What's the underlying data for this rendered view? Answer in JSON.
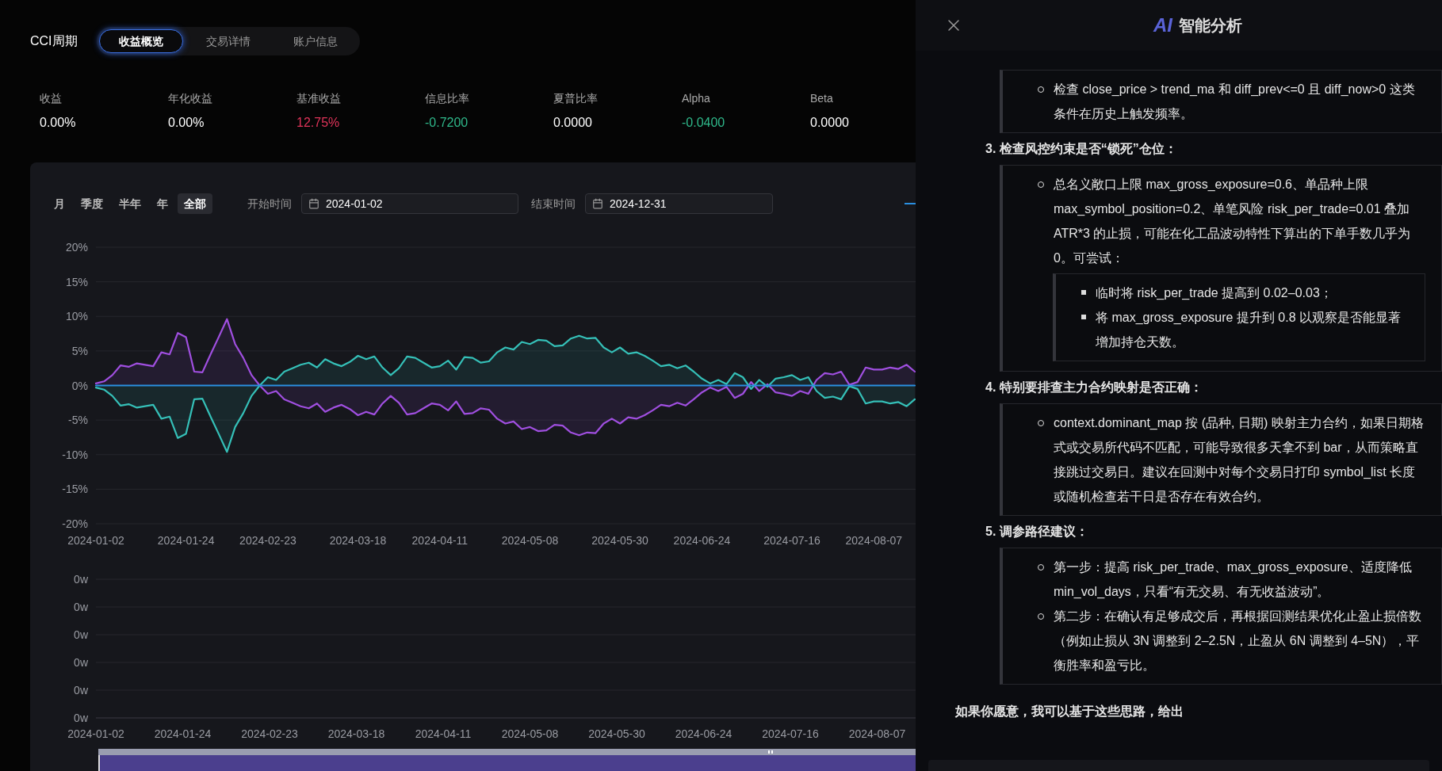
{
  "header": {
    "strategy": "CCI周期",
    "tabs": [
      {
        "label": "收益概览",
        "selected": true
      },
      {
        "label": "交易详情",
        "selected": false
      },
      {
        "label": "账户信息",
        "selected": false
      }
    ]
  },
  "metrics": [
    {
      "label": "收益",
      "value": "0.00%",
      "color": "#ffffff"
    },
    {
      "label": "年化收益",
      "value": "0.00%",
      "color": "#ffffff"
    },
    {
      "label": "基准收益",
      "value": "12.75%",
      "color": "#e0345a"
    },
    {
      "label": "信息比率",
      "value": "-0.7200",
      "color": "#2fb88a"
    },
    {
      "label": "夏普比率",
      "value": "0.0000",
      "color": "#ffffff"
    },
    {
      "label": "Alpha",
      "value": "-0.0400",
      "color": "#2fb88a"
    },
    {
      "label": "Beta",
      "value": "0.0000",
      "color": "#ffffff"
    }
  ],
  "toolbar": {
    "periods": [
      {
        "label": "月",
        "selected": false
      },
      {
        "label": "季度",
        "selected": false
      },
      {
        "label": "半年",
        "selected": false
      },
      {
        "label": "年",
        "selected": false
      },
      {
        "label": "全部",
        "selected": true
      }
    ],
    "start_label": "开始时间",
    "start_value": "2024-01-02",
    "end_label": "结束时间",
    "end_value": "2024-12-31"
  },
  "returns_chart": {
    "chart_data": {
      "type": "line",
      "grid": true,
      "ylim": [
        -20,
        20
      ],
      "categories": [
        "2024-01-02",
        null,
        null,
        null,
        null,
        null,
        null,
        null,
        null,
        null,
        null,
        "2024-01-24",
        null,
        null,
        null,
        null,
        null,
        null,
        null,
        null,
        null,
        "2024-02-23",
        null,
        null,
        null,
        null,
        null,
        null,
        null,
        null,
        null,
        null,
        "2024-03-18",
        null,
        null,
        null,
        null,
        null,
        null,
        null,
        null,
        null,
        "2024-04-11",
        null,
        null,
        null,
        null,
        null,
        null,
        null,
        null,
        null,
        null,
        "2024-05-08",
        null,
        null,
        null,
        null,
        null,
        null,
        null,
        null,
        null,
        null,
        "2024-05-30",
        null,
        null,
        null,
        null,
        null,
        null,
        null,
        null,
        null,
        "2024-06-24",
        null,
        null,
        null,
        null,
        null,
        null,
        null,
        null,
        null,
        null,
        "2024-07-16",
        null,
        null,
        null,
        null,
        null,
        null,
        null,
        null,
        null,
        "2024-08-07",
        null,
        null,
        null,
        null,
        null
      ],
      "yticks": [
        {
          "value": 20,
          "label": "20%"
        },
        {
          "value": 15,
          "label": "15%"
        },
        {
          "value": 10,
          "label": "10%"
        },
        {
          "value": 5,
          "label": "5%"
        },
        {
          "value": 0,
          "label": "0%"
        },
        {
          "value": -5,
          "label": "-5%"
        },
        {
          "value": -10,
          "label": "-10%"
        },
        {
          "value": -15,
          "label": "-15%"
        },
        {
          "value": -20,
          "label": "-20%"
        }
      ],
      "series": [
        {
          "color": "#a04fe0",
          "values": [
            0.3,
            0.6,
            1.5,
            2.9,
            2.7,
            3.2,
            3.0,
            2.8,
            4.8,
            4.5,
            7.6,
            7.0,
            2.0,
            1.9,
            4.5,
            7.0,
            9.6,
            6.0,
            4.0,
            1.5,
            0.0,
            -1.2,
            -0.8,
            -2.0,
            -2.5,
            -3.0,
            -3.3,
            -2.6,
            -3.8,
            -3.2,
            -2.8,
            -3.4,
            -4.3,
            -3.8,
            -4.2,
            -2.6,
            -1.5,
            -2.5,
            -4.2,
            -4.0,
            -3.3,
            -2.6,
            -2.8,
            -3.6,
            -2.3,
            -4.1,
            -4.0,
            -3.3,
            -3.5,
            -4.8,
            -5.5,
            -5.2,
            -6.3,
            -6.0,
            -6.6,
            -6.5,
            -5.7,
            -5.8,
            -6.8,
            -7.2,
            -6.8,
            -6.9,
            -5.5,
            -4.8,
            -5.5,
            -4.6,
            -4.8,
            -4.3,
            -3.6,
            -2.8,
            -3.0,
            -2.5,
            -2.9,
            -2.0,
            -1.0,
            -0.3,
            -0.8,
            -0.2,
            -1.8,
            -1.2,
            0.5,
            -0.8,
            0.2,
            -1.0,
            -1.2,
            -1.5,
            -0.8,
            -1.2,
            0.8,
            1.8,
            1.6,
            2.0,
            0.1,
            0.5,
            2.6,
            2.3,
            2.3,
            2.6,
            2.4,
            3.0,
            2.0
          ]
        },
        {
          "color": "#35c0b8",
          "values": [
            -0.3,
            -0.6,
            -1.5,
            -2.9,
            -2.7,
            -3.2,
            -3.0,
            -2.8,
            -4.8,
            -4.5,
            -7.6,
            -7.0,
            -2.0,
            -1.9,
            -4.5,
            -7.0,
            -9.6,
            -6.0,
            -4.0,
            -1.5,
            0.0,
            1.2,
            0.8,
            2.0,
            2.5,
            3.0,
            3.3,
            2.6,
            3.8,
            3.2,
            2.8,
            3.4,
            4.3,
            3.8,
            4.2,
            2.6,
            1.5,
            2.5,
            4.2,
            4.0,
            3.3,
            2.6,
            2.8,
            3.6,
            2.3,
            4.1,
            4.0,
            3.3,
            3.5,
            4.8,
            5.5,
            5.2,
            6.3,
            6.0,
            6.6,
            6.5,
            5.7,
            5.8,
            6.8,
            7.2,
            6.8,
            6.9,
            5.5,
            4.8,
            5.5,
            4.6,
            4.8,
            4.3,
            3.6,
            2.8,
            3.0,
            2.5,
            2.9,
            2.0,
            1.0,
            0.3,
            0.8,
            0.2,
            1.8,
            1.2,
            -0.5,
            0.8,
            -0.2,
            1.0,
            1.2,
            1.5,
            0.8,
            1.2,
            -0.8,
            -1.8,
            -1.6,
            -2.0,
            -0.1,
            -0.5,
            -2.6,
            -2.3,
            -2.3,
            -2.6,
            -2.4,
            -3.0,
            -2.0
          ]
        },
        {
          "color": "#2a8fe0",
          "values": [
            0,
            0,
            0,
            0,
            0,
            0,
            0,
            0,
            0,
            0,
            0,
            0,
            0,
            0,
            0,
            0,
            0,
            0,
            0,
            0,
            0,
            0,
            0,
            0,
            0,
            0,
            0,
            0,
            0,
            0,
            0,
            0,
            0,
            0,
            0,
            0,
            0,
            0,
            0,
            0,
            0,
            0,
            0,
            0,
            0,
            0,
            0,
            0,
            0,
            0,
            0,
            0,
            0,
            0,
            0,
            0,
            0,
            0,
            0,
            0,
            0,
            0,
            0,
            0,
            0,
            0,
            0,
            0,
            0,
            0,
            0,
            0,
            0,
            0,
            0,
            0,
            0,
            0,
            0,
            0,
            0,
            0,
            0,
            0,
            0,
            0,
            0,
            0,
            0,
            0,
            0,
            0,
            0,
            0,
            0,
            0,
            0,
            0,
            0,
            0,
            0
          ]
        }
      ]
    }
  },
  "zoom_slider": {
    "level": 1
  },
  "volume_chart": {
    "y_labels": [
      "0w",
      "0w",
      "0w",
      "0w",
      "0w",
      "0w"
    ],
    "x_labels": [
      "2024-01-02",
      "2024-01-24",
      "2024-02-23",
      "2024-03-18",
      "2024-04-11",
      "2024-05-08",
      "2024-05-30",
      "2024-06-24",
      "2024-07-16",
      "2024-08-07"
    ]
  },
  "panel": {
    "title_mark": "AI",
    "title": "智能分析",
    "blocks": [
      {
        "kind": "box",
        "bullets": [
          {
            "text": "检查 close_price > trend_ma 和 diff_prev<=0 且 diff_now>0 这类条件在历史上触发频率。"
          }
        ]
      },
      {
        "kind": "heading",
        "text": "3. 检查风控约束是否“锁死”仓位："
      },
      {
        "kind": "box",
        "bullets": [
          {
            "text": "总名义敞口上限 max_gross_exposure=0.6、单品种上限 max_symbol_position=0.2、单笔风险 risk_per_trade=0.01 叠加 ATR*3 的止损，可能在化工品波动特性下算出的下单手数几乎为 0。可尝试：",
            "children": [
              {
                "text": "临时将 risk_per_trade 提高到 0.02–0.03；"
              },
              {
                "text": "将 max_gross_exposure 提升到 0.8 以观察是否能显著增加持仓天数。"
              }
            ]
          }
        ]
      },
      {
        "kind": "heading",
        "text": "4. 特别要排查主力合约映射是否正确："
      },
      {
        "kind": "box",
        "bullets": [
          {
            "text": "context.dominant_map 按 (品种, 日期) 映射主力合约，如果日期格式或交易所代码不匹配，可能导致很多天拿不到 bar，从而策略直接跳过交易日。建议在回测中对每个交易日打印 symbol_list 长度或随机检查若干日是否存在有效合约。"
          }
        ]
      },
      {
        "kind": "heading",
        "text": "5. 调参路径建议："
      },
      {
        "kind": "box",
        "bullets": [
          {
            "text": "第一步：提高 risk_per_trade、max_gross_exposure、适度降低 min_vol_days，只看“有无交易、有无收益波动”。"
          },
          {
            "text": "第二步：在确认有足够成交后，再根据回测结果优化止盈止损倍数（例如止损从 3N 调整到 2–2.5N，止盈从 6N 调整到 4–5N），平衡胜率和盈亏比。"
          }
        ]
      },
      {
        "kind": "paragraph",
        "text": "如果你愿意，我可以基于这些思路，给出"
      }
    ]
  }
}
